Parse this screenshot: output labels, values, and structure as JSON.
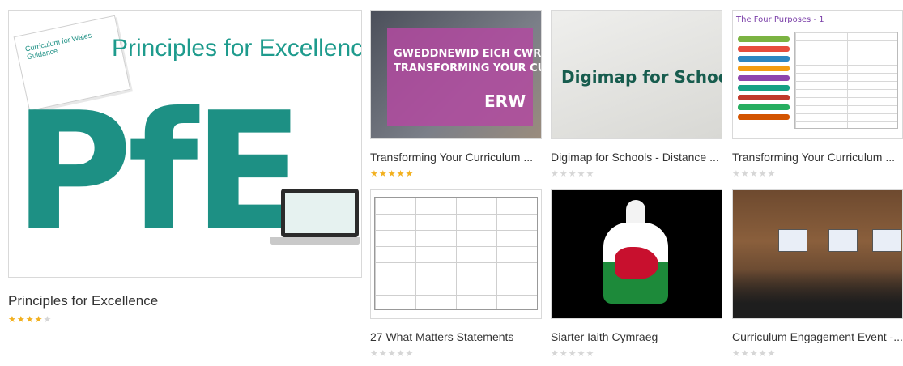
{
  "featured": {
    "title": "Principles for Excellence",
    "rating": 4,
    "thumb": {
      "heading": "Principles for Excellence",
      "letters": "PfE",
      "book_text": "Curriculum for Wales Guidance"
    }
  },
  "cards": [
    {
      "title": "Transforming Your Curriculum ...",
      "rating": 5,
      "thumb": {
        "line1": "GWEDDNEWID EICH CWRICWLWM",
        "line2": "TRANSFORMING YOUR CURRICULUM",
        "logo": "ERW"
      }
    },
    {
      "title": "Digimap for Schools - Distance ...",
      "rating": 0,
      "thumb": {
        "text": "Digimap for Schools"
      }
    },
    {
      "title": "Transforming Your Curriculum ...",
      "rating": 0,
      "thumb": {
        "text": "The Four Purposes - 1"
      }
    },
    {
      "title": "27 What Matters Statements",
      "rating": 0,
      "thumb": {}
    },
    {
      "title": "Siarter Iaith Cymraeg",
      "rating": 0,
      "thumb": {}
    },
    {
      "title": "Curriculum Engagement Event -...",
      "rating": 0,
      "thumb": {}
    }
  ],
  "colors": {
    "star_on": "#f2b01e",
    "star_off": "#d6d6d6",
    "pfe_teal": "#1d9084"
  },
  "icons": {
    "rating": "star-icon"
  }
}
